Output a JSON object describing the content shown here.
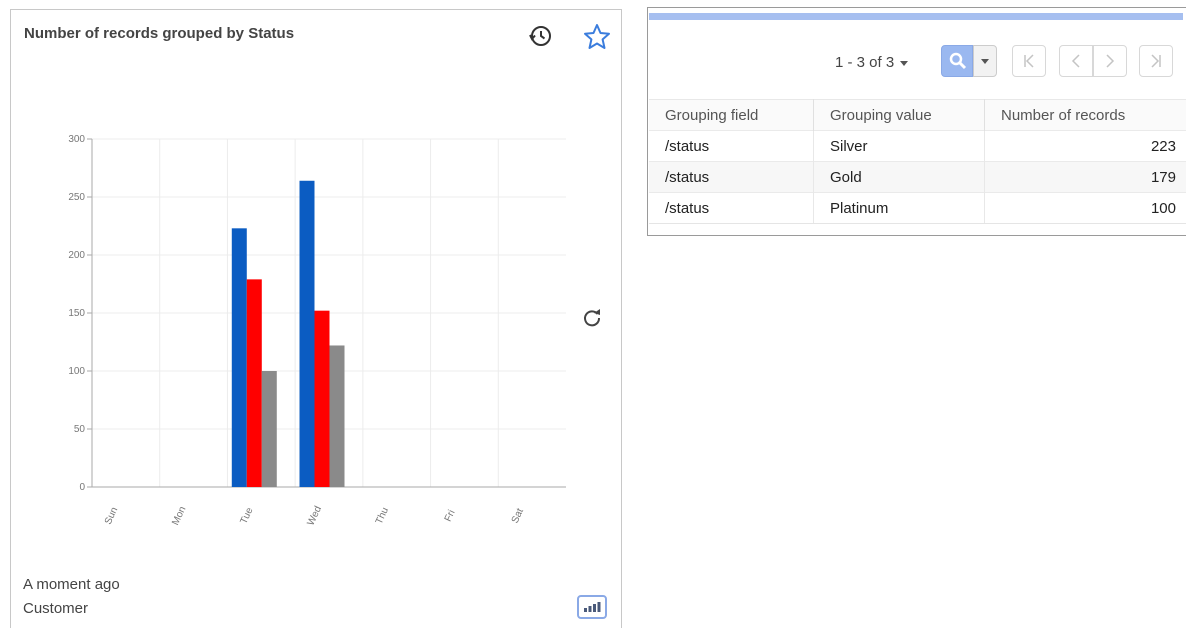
{
  "widget": {
    "title": "Number of records grouped by Status",
    "footer_time": "A moment ago",
    "footer_entity": "Customer"
  },
  "chart_data": {
    "type": "bar",
    "categories": [
      "Sun",
      "Mon",
      "Tue",
      "Wed",
      "Thu",
      "Fri",
      "Sat"
    ],
    "series": [
      {
        "color": "#0b5cc2",
        "values": [
          0,
          0,
          223,
          264,
          0,
          0,
          0
        ]
      },
      {
        "color": "#ff0000",
        "values": [
          0,
          0,
          179,
          152,
          0,
          0,
          0
        ]
      },
      {
        "color": "#8a8a8a",
        "values": [
          0,
          0,
          100,
          122,
          0,
          0,
          0
        ]
      }
    ],
    "ylim": [
      0,
      300
    ],
    "yticks": [
      "0",
      "50",
      "100",
      "150",
      "200",
      "250",
      "300"
    ],
    "grid": true
  },
  "table": {
    "pager_text": "1 - 3 of 3",
    "columns": [
      "Grouping field",
      "Grouping value",
      "Number of records"
    ],
    "rows": [
      [
        "/status",
        "Silver",
        "223"
      ],
      [
        "/status",
        "Gold",
        "179"
      ],
      [
        "/status",
        "Platinum",
        "100"
      ]
    ]
  },
  "icons": {
    "history": "history-icon",
    "favorite": "star-icon",
    "refresh": "refresh-icon",
    "chart_type": "bar-chart-icon",
    "search": "search-icon"
  },
  "colors": {
    "accent": "#a6bff0",
    "search_button": "#9ab8f0"
  }
}
